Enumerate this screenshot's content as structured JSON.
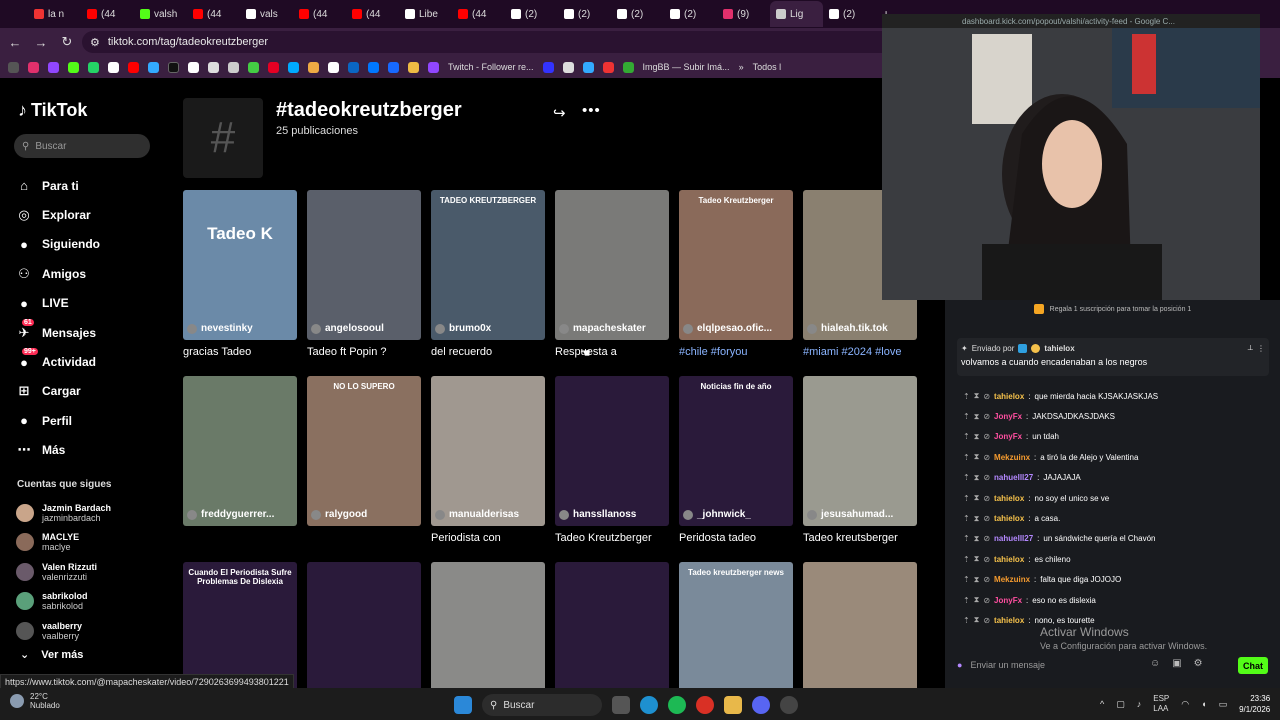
{
  "browser": {
    "tabs": [
      {
        "label": "la n",
        "color": "#e33"
      },
      {
        "label": "(44",
        "color": "#f00"
      },
      {
        "label": "valsh",
        "color": "#53fc18"
      },
      {
        "label": "(44",
        "color": "#f00"
      },
      {
        "label": "vals",
        "color": "#fff"
      },
      {
        "label": "(44",
        "color": "#f00"
      },
      {
        "label": "(44",
        "color": "#f00"
      },
      {
        "label": "Libe",
        "color": "#fff"
      },
      {
        "label": "(44",
        "color": "#f00"
      },
      {
        "label": "(2)",
        "color": "#fff"
      },
      {
        "label": "(2)",
        "color": "#fff"
      },
      {
        "label": "(2)",
        "color": "#fff"
      },
      {
        "label": "(2)",
        "color": "#fff"
      },
      {
        "label": "(9)",
        "color": "#e1306c"
      },
      {
        "label": "Lig",
        "color": "#ccc"
      },
      {
        "label": "(2)",
        "color": "#fff"
      }
    ],
    "url": "tiktok.com/tag/tadeokreutzberger",
    "bookmarks": {
      "twitch": "Twitch - Follower re...",
      "imgbb": "ImgBB — Subir Imá...",
      "todos": "Todos l"
    }
  },
  "sidebar": {
    "logo": "TikTok",
    "search_placeholder": "Buscar",
    "nav": [
      {
        "label": "Para ti",
        "icon": "home-icon",
        "glyph": "⌂"
      },
      {
        "label": "Explorar",
        "icon": "compass-icon",
        "glyph": "◎"
      },
      {
        "label": "Siguiendo",
        "icon": "following-icon",
        "glyph": "●"
      },
      {
        "label": "Amigos",
        "icon": "friends-icon",
        "glyph": "⚇"
      },
      {
        "label": "LIVE",
        "icon": "live-icon",
        "glyph": "●"
      },
      {
        "label": "Mensajes",
        "icon": "messages-icon",
        "glyph": "✈",
        "badge": "61"
      },
      {
        "label": "Actividad",
        "icon": "activity-icon",
        "glyph": "●",
        "badge": "99+"
      },
      {
        "label": "Cargar",
        "icon": "upload-icon",
        "glyph": "⊞"
      },
      {
        "label": "Perfil",
        "icon": "profile-icon",
        "glyph": "●"
      },
      {
        "label": "Más",
        "icon": "more-icon",
        "glyph": "⋯"
      }
    ],
    "following_title": "Cuentas que sigues",
    "following": [
      {
        "name": "Jazmin Bardach",
        "user": "jazminbardach",
        "color": "#c9a58a"
      },
      {
        "name": "MACLYE",
        "user": "maclye",
        "color": "#8a6a5a"
      },
      {
        "name": "Valen Rizzuti",
        "user": "valenrizzuti",
        "color": "#6a5a6a"
      },
      {
        "name": "sabrikolod",
        "user": "sabrikolod",
        "color": "#5aa07a"
      },
      {
        "name": "vaalberry",
        "user": "vaalberry",
        "color": "#555"
      }
    ],
    "ver_mas": "Ver más"
  },
  "hashtag": {
    "title": "#tadeokreutzberger",
    "count": "25 publicaciones"
  },
  "videos": [
    {
      "author": "nevestinky",
      "caption": "gracias Tadeo",
      "overlay": "Tadeo K",
      "bg": "#6b8aa8"
    },
    {
      "author": "angelosooul",
      "caption": "Tadeo ft Popin ?",
      "overlay": "",
      "bg": "#5a5f6a"
    },
    {
      "author": "brumo0x",
      "caption": "del recuerdo",
      "overlay": "TADEO KREUTZBERGER",
      "bg": "#4a5a6a"
    },
    {
      "author": "mapacheskater",
      "caption": "Respuesta a",
      "overlay": "",
      "bg": "#7a7a78"
    },
    {
      "author": "elqlpesao.ofic...",
      "caption": "#chile #foryou",
      "overlay": "Tadeo Kreutzberger",
      "bg": "#8a6a5a",
      "blue": true
    },
    {
      "author": "hialeah.tik.tok",
      "caption": "#miami #2024 #love",
      "overlay": "",
      "bg": "#8a8070",
      "blue": true
    },
    {
      "author": "freddyguerrer...",
      "caption": "",
      "overlay": "",
      "bg": "#6a7a68"
    },
    {
      "author": "ralygood",
      "caption": "",
      "overlay": "NO LO SUPERO",
      "bg": "#8a7060"
    },
    {
      "author": "manualderisas",
      "caption": "Periodista con",
      "overlay": "",
      "bg": "#a09890"
    },
    {
      "author": "hanssllanoss",
      "caption": "Tadeo Kreutzberger",
      "overlay": "",
      "bg": "#2a1a3a"
    },
    {
      "author": "_johnwick_",
      "caption": "Peridosta tadeo",
      "overlay": "Noticias fin de año",
      "bg": "#2a1a3a"
    },
    {
      "author": "jesusahumad...",
      "caption": "Tadeo kreutsberger",
      "overlay": "",
      "bg": "#9a9a90"
    },
    {
      "author": "",
      "caption": "",
      "overlay": "Cuando El Periodista Sufre Problemas De Dislexia",
      "bg": "#2a1a3a"
    },
    {
      "author": "",
      "caption": "",
      "overlay": "",
      "bg": "#2a1a3a"
    },
    {
      "author": "",
      "caption": "",
      "overlay": "",
      "bg": "#8a8a88"
    },
    {
      "author": "",
      "caption": "",
      "overlay": "",
      "bg": "#2a1a3a"
    },
    {
      "author": "",
      "caption": "",
      "overlay": "Tadeo kreutzberger news",
      "bg": "#7a8a9a"
    },
    {
      "author": "",
      "caption": "",
      "overlay": "",
      "bg": "#9a8a7a"
    }
  ],
  "status_url": "https://www.tiktok.com/@mapacheskater/video/7290263699493801221",
  "stream": {
    "cam_url": "dashboard.kick.com/popout/valshi/activity-feed - Google C...",
    "tip": "Regala 1 suscripción para tomar la posición 1",
    "pinned_by_label": "Enviado por",
    "pinned_by_user": "tahielox",
    "pinned_msg": "volvamos a cuando encadenaban a los negros",
    "messages": [
      {
        "user": "tahielox",
        "color": "#f5c14b",
        "text": "que mierda hacia KJSAKJASKJAS"
      },
      {
        "user": "JonyFx",
        "color": "#ff4fa0",
        "text": "JAKDSAJDKASJDAKS"
      },
      {
        "user": "JonyFx",
        "color": "#ff4fa0",
        "text": "un tdah"
      },
      {
        "user": "Mekzuinx",
        "color": "#f59b2f",
        "text": "a tiró la de Alejo y Valentina"
      },
      {
        "user": "nahuelll27",
        "color": "#b488ff",
        "text": "JAJAJAJA"
      },
      {
        "user": "tahielox",
        "color": "#f5c14b",
        "text": "no soy el unico se ve"
      },
      {
        "user": "tahielox",
        "color": "#f5c14b",
        "text": "a casa."
      },
      {
        "user": "nahuelll27",
        "color": "#b488ff",
        "text": "un sándwiche quería el Chavón"
      },
      {
        "user": "tahielox",
        "color": "#f5c14b",
        "text": "es chileno"
      },
      {
        "user": "Mekzuinx",
        "color": "#f59b2f",
        "text": "falta que diga JOJOJO"
      },
      {
        "user": "JonyFx",
        "color": "#ff4fa0",
        "text": "eso no es dislexia"
      },
      {
        "user": "tahielox",
        "color": "#f5c14b",
        "text": "nono, es tourette"
      }
    ],
    "input_placeholder": "Enviar un mensaje",
    "chat_button": "Chat"
  },
  "watermark": {
    "title": "Activar Windows",
    "sub": "Ve a Configuración para activar Windows."
  },
  "taskbar": {
    "temp": "22°C",
    "weather": "Nublado",
    "search": "Buscar",
    "lang1": "ESP",
    "lang2": "LAA",
    "time": "23:36",
    "date": "9/1/2026"
  }
}
